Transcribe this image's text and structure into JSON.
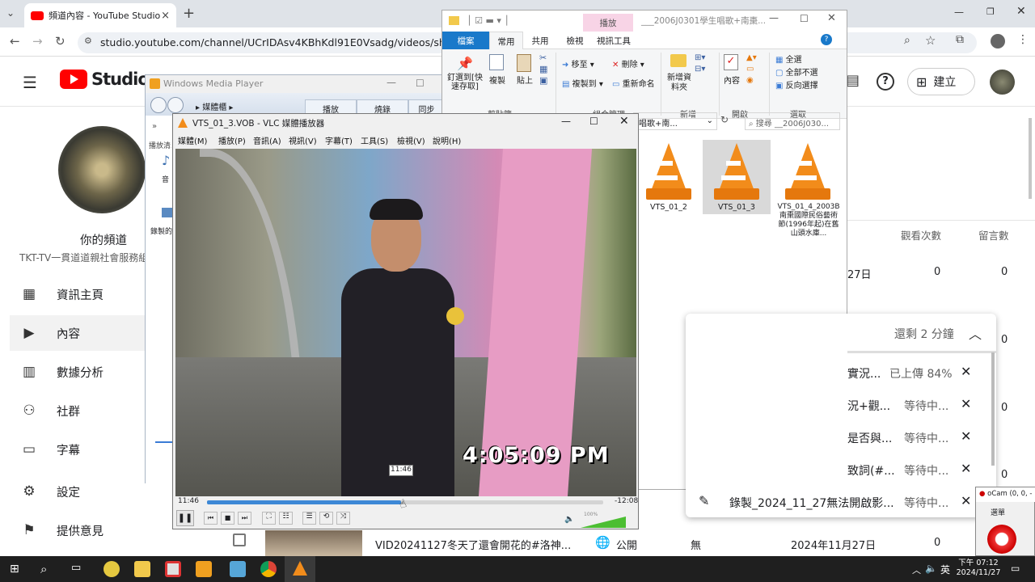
{
  "browser": {
    "tab_title": "頻道內容 - YouTube Studio",
    "url": "studio.youtube.com/channel/UCrIDAsv4KBhKdl91E0Vsadg/videos/short?filter=%"
  },
  "studio": {
    "logo": "Studio",
    "create_label": "建立",
    "channel_label": "你的頻道",
    "channel_name": "TKT-TV一貫道道親社會服務組",
    "nav": [
      "資訊主頁",
      "內容",
      "數據分析",
      "社群",
      "字幕",
      "設定",
      "提供意見"
    ],
    "col_views": "觀看次數",
    "col_comments": "留言數",
    "row1_date": "27日",
    "row1_views": "0",
    "row1_comments": "0",
    "extra_zeros": [
      "0",
      "0",
      "0"
    ],
    "bottom_row": {
      "title": "VID20241127冬天了還會開花的#洛神...",
      "visibility": "公開",
      "restrictions": "無",
      "date": "2024年11月27日",
      "views": "0"
    }
  },
  "wmp": {
    "title": "Windows Media Player",
    "breadcrumb": "媒體櫃",
    "tabs": [
      "播放",
      "燒錄",
      "同步"
    ],
    "side_labels": [
      "播放清單",
      "音",
      "錄製的"
    ]
  },
  "explorer": {
    "context_tab": "播放",
    "title": "___2006J0301學生唱歌+南棗...",
    "tabs": [
      "檔案",
      "常用",
      "共用",
      "檢視",
      "視訊工具"
    ],
    "ribbon": {
      "pin": "釘選到[快速存取]",
      "copy": "複製",
      "paste": "貼上",
      "move_to": "移至",
      "copy_to": "複製到",
      "delete": "刪除",
      "rename": "重新命名",
      "new_folder": "新增資料夾",
      "properties": "內容",
      "select_all": "全選",
      "select_none": "全部不選",
      "invert": "反向選擇",
      "groups": [
        "剪貼簿",
        "組合管理",
        "新增",
        "開啟",
        "選取"
      ]
    },
    "address_tail": "唱歌+南...",
    "search_placeholder": "搜尋 __2006J030...",
    "files": [
      "VTS_01_2",
      "VTS_01_3",
      "VTS_01_4_2003B南棗國際民俗藝術節(1996年起)在舊山頭水庫..."
    ]
  },
  "vlc": {
    "title": "VTS_01_3.VOB - VLC 媒體播放器",
    "menu": [
      "媒體(M)",
      "播放(P)",
      "音訊(A)",
      "視訊(V)",
      "字幕(T)",
      "工具(S)",
      "檢視(V)",
      "說明(H)"
    ],
    "timestamp_overlay": "4:05:09 PM",
    "tooltip_time": "11:46",
    "elapsed": "11:46",
    "remaining": "-12:08",
    "progress": 0.49,
    "volume_label": "100%",
    "volume": 1.0
  },
  "upload": {
    "header": "還剩 2 分鐘",
    "rows": [
      {
        "title": "實況...",
        "status": "已上傳 84%"
      },
      {
        "title": "況+觀...",
        "status": "等待中..."
      },
      {
        "title": "是否與...",
        "status": "等待中..."
      },
      {
        "title": "致詞(#...",
        "status": "等待中..."
      },
      {
        "title": "錄製_2024_11_27無法開啟影...",
        "status": "等待中..."
      }
    ]
  },
  "ocam": {
    "title": "oCam (0, 0, -",
    "menu": "選單"
  },
  "taskbar": {
    "time": "下午 07:12",
    "date": "2024/11/27",
    "ime": "英"
  }
}
